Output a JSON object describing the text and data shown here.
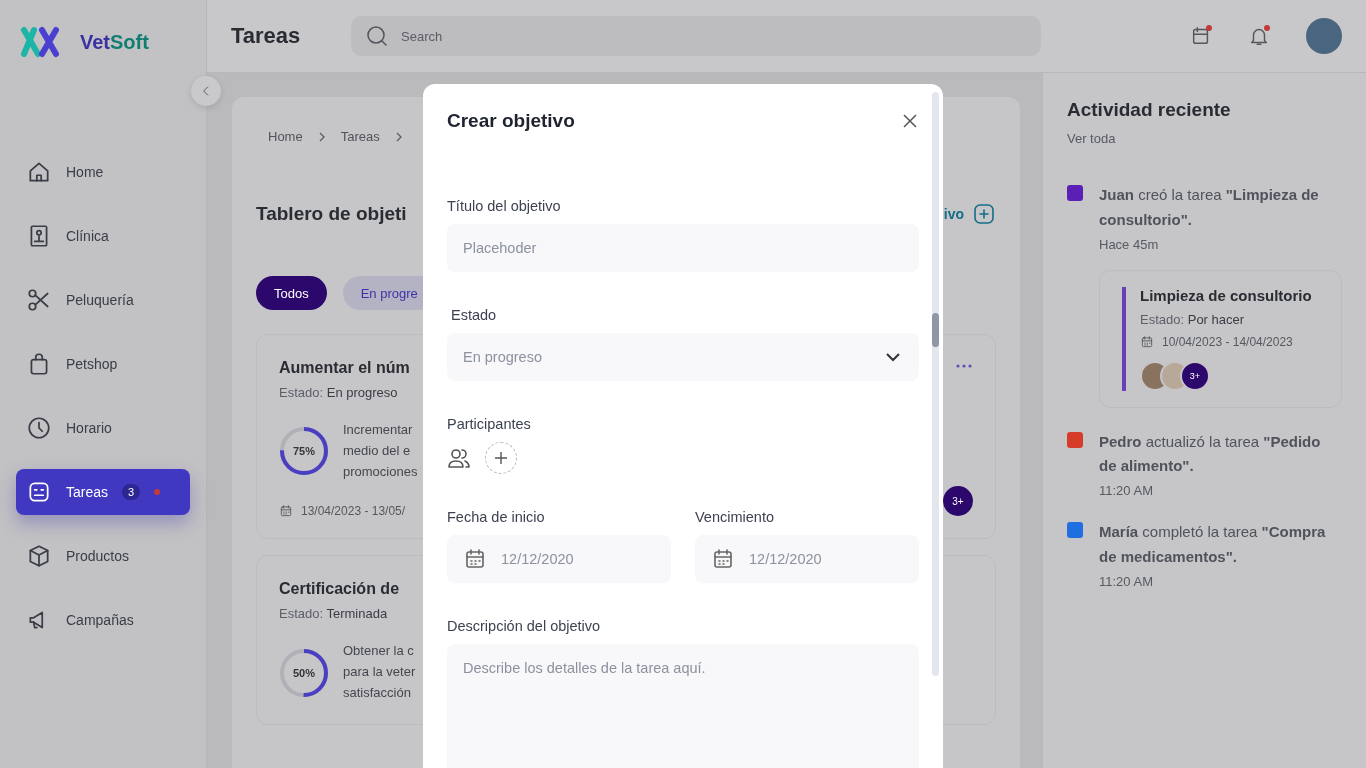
{
  "sidebar": {
    "logo": [
      "Vet",
      "Soft"
    ],
    "items": [
      {
        "label": "Home",
        "selected": false
      },
      {
        "label": "Clínica",
        "selected": false
      },
      {
        "label": "Peluquería",
        "selected": false
      },
      {
        "label": "Petshop",
        "selected": false
      },
      {
        "label": "Horario",
        "selected": false
      },
      {
        "label": "Tareas",
        "selected": true,
        "badge": "3",
        "alert": true
      },
      {
        "label": "Productos",
        "selected": false
      },
      {
        "label": "Campañas",
        "selected": false
      }
    ]
  },
  "topbar": {
    "title": "Tareas",
    "search": {
      "placeholder": "Search"
    },
    "calendar_alert": true,
    "bell_alert": true
  },
  "board": {
    "breadcrumb": [
      "Home",
      "Tareas"
    ],
    "title": "Tablero de objeti",
    "new_button": "ivo",
    "filters": [
      {
        "label": "Todos",
        "selected": true
      },
      {
        "label": "En progre",
        "selected": false
      }
    ],
    "cards": [
      {
        "title": "Aumentar el núm",
        "status_label": "Estado:",
        "status": "En progreso",
        "level": 0.75,
        "reading": "75%",
        "description": "Incrementar\nmedio del e\npromociones",
        "dates": "13/04/2023 - 13/05/",
        "more": true,
        "extra": "3+"
      },
      {
        "title": "Certificación de",
        "status_label": "Estado:",
        "status": "Terminada",
        "level": 0.5,
        "reading": "50%",
        "description": "Obtener la c\npara la veter\nsatisfacción"
      }
    ]
  },
  "activity": {
    "title": "Actividad reciente",
    "link": "Ver toda",
    "items": [
      {
        "color": "#5b1fb8",
        "text": "**Juan** creó la tarea **\"Limpieza de consultorio\".**",
        "time": "Hace 45m",
        "task": {
          "title": "Limpieza de consultorio",
          "status_label": "Estado:",
          "status": "Por hacer",
          "dates": "10/04/2023 - 14/04/2023",
          "extra": "3+"
        }
      },
      {
        "color": "#d63c2a",
        "text": "**Pedro** actualizó la tarea **\"Pedido de alimento\".**",
        "time": "11:20 AM"
      },
      {
        "color": "#1f6fe0",
        "text": "**María** completó la tarea **\"Compra de medicamentos\".**",
        "time": "11:20 AM"
      }
    ]
  },
  "modal": {
    "title": "Crear objetivo",
    "title_field": {
      "label": "Título del objetivo",
      "placeholder": "Placehoder"
    },
    "status_field": {
      "label": "Estado",
      "value": "En progreso"
    },
    "participants": {
      "label": "Participantes"
    },
    "start": {
      "label": "Fecha de inicio",
      "value": "12/12/2020"
    },
    "due": {
      "label": "Vencimiento",
      "value": "12/12/2020"
    },
    "description": {
      "label": "Descripción del objetivo",
      "placeholder": "Describe los detalles de la tarea aquí."
    }
  }
}
